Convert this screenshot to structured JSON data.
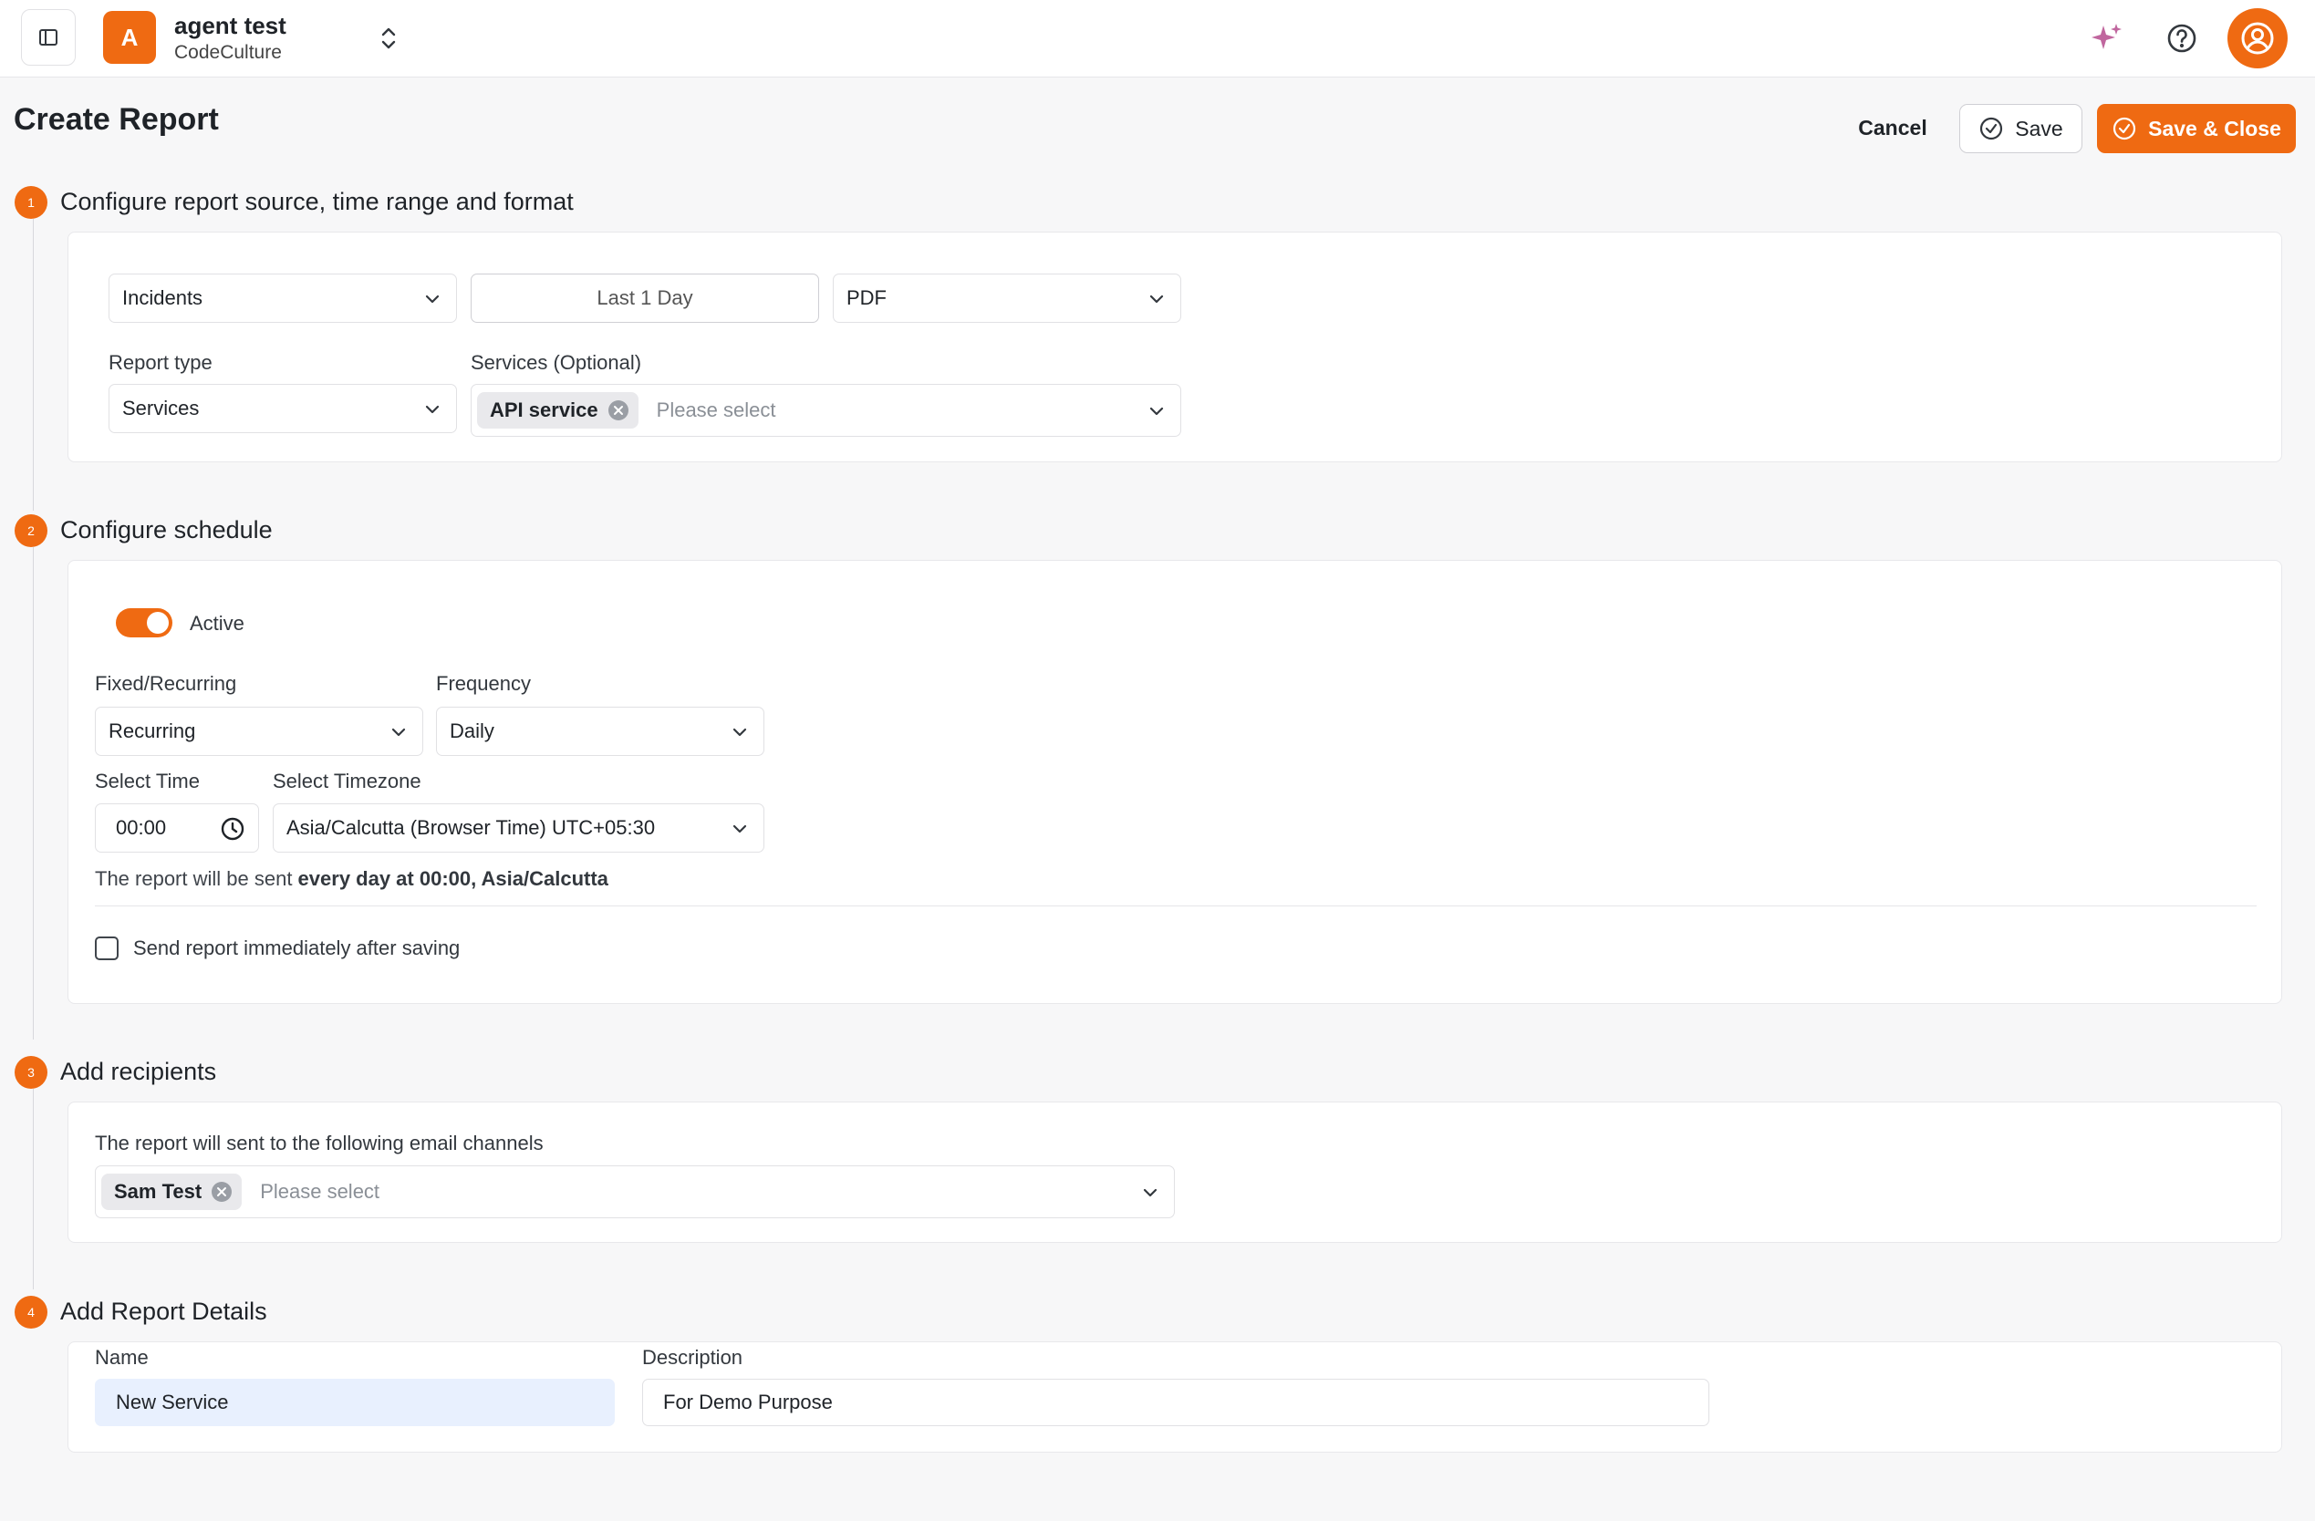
{
  "topbar": {
    "org_initial": "A",
    "org_name": "agent test",
    "org_sub": "CodeCulture"
  },
  "header": {
    "title": "Create Report",
    "cancel_label": "Cancel",
    "save_label": "Save",
    "save_close_label": "Save & Close"
  },
  "steps": [
    {
      "number": "1",
      "title": "Configure report source, time range and format"
    },
    {
      "number": "2",
      "title": "Configure schedule"
    },
    {
      "number": "3",
      "title": "Add recipients"
    },
    {
      "number": "4",
      "title": "Add Report Details"
    }
  ],
  "source": {
    "source_value": "Incidents",
    "time_range": "Last 1 Day",
    "format_value": "PDF",
    "report_type_label": "Report type",
    "report_type_value": "Services",
    "services_label": "Services (Optional)",
    "services_tags": [
      "API service"
    ],
    "services_placeholder": "Please select"
  },
  "schedule": {
    "active_label": "Active",
    "active": true,
    "fixed_label": "Fixed/Recurring",
    "fixed_value": "Recurring",
    "frequency_label": "Frequency",
    "frequency_value": "Daily",
    "time_label": "Select Time",
    "time_value": "00:00",
    "timezone_label": "Select Timezone",
    "timezone_value": "Asia/Calcutta (Browser Time) UTC+05:30",
    "summary_prefix": "The report will be sent ",
    "summary_bold": "every day at 00:00, Asia/Calcutta",
    "send_now_label": "Send report immediately after saving",
    "send_now_checked": false
  },
  "recipients": {
    "label": "The report will sent to the following email channels",
    "tags": [
      "Sam Test"
    ],
    "placeholder": "Please select"
  },
  "details": {
    "name_label": "Name",
    "name_value": "New Service",
    "description_label": "Description",
    "description_value": "For Demo Purpose"
  },
  "colors": {
    "accent": "#ef6a12",
    "ai_icon": "#c0669e"
  }
}
